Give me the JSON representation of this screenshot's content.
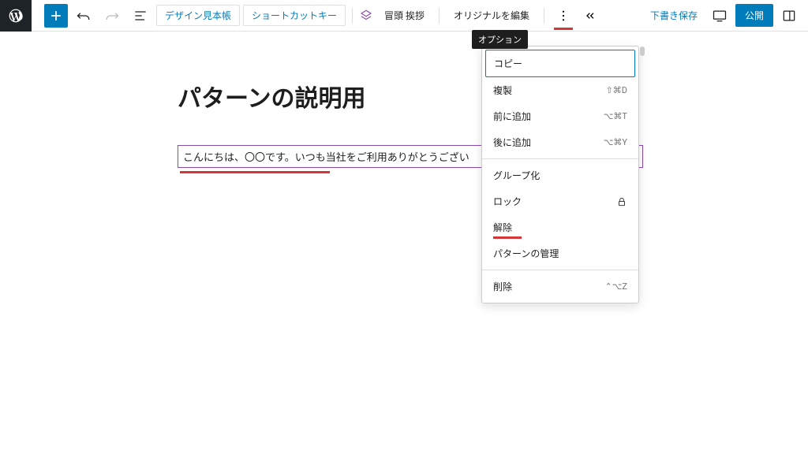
{
  "toolbar": {
    "pill1": "デザイン見本帳",
    "pill2": "ショートカットキー",
    "block_label": "冒頭 挨拶",
    "edit_original": "オリジナルを編集",
    "save_draft": "下書き保存",
    "publish": "公開"
  },
  "tooltip": "オプション",
  "content": {
    "title": "パターンの説明用",
    "block_text": "こんにちは、〇〇です。いつも当社をご利用ありがとうござい"
  },
  "menu": {
    "copy": "コピー",
    "duplicate": "複製",
    "duplicate_shortcut": "⇧⌘D",
    "add_before": "前に追加",
    "add_before_shortcut": "⌥⌘T",
    "add_after": "後に追加",
    "add_after_shortcut": "⌥⌘Y",
    "group": "グループ化",
    "lock": "ロック",
    "detach": "解除",
    "manage_patterns": "パターンの管理",
    "delete": "削除",
    "delete_shortcut": "⌃⌥Z"
  }
}
